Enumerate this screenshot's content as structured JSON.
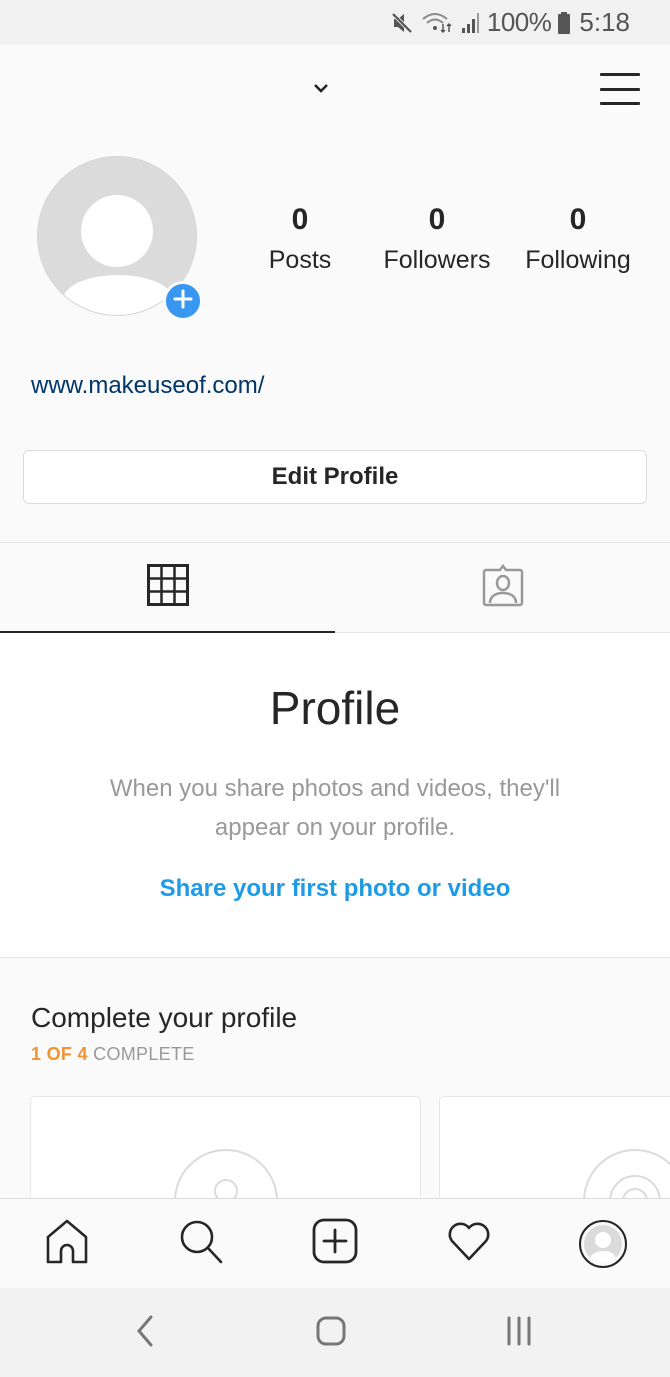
{
  "status_bar": {
    "icons": [
      "mute-icon",
      "wifi-icon",
      "signal-icon",
      "battery-icon"
    ],
    "battery_percent": "100%",
    "time": "5:18"
  },
  "header": {
    "username": "",
    "dropdown_icon": "chevron-down-icon",
    "menu_icon": "hamburger-menu-icon"
  },
  "profile": {
    "avatar_icon": "default-avatar-icon",
    "add_photo_icon": "plus-icon",
    "stats": [
      {
        "value": "0",
        "label": "Posts"
      },
      {
        "value": "0",
        "label": "Followers"
      },
      {
        "value": "0",
        "label": "Following"
      }
    ],
    "website": "www.makeuseof.com/",
    "edit_profile_label": "Edit Profile"
  },
  "tabs": [
    {
      "name": "grid",
      "icon": "grid-icon",
      "active": true
    },
    {
      "name": "tagged",
      "icon": "tagged-person-icon",
      "active": false
    }
  ],
  "empty_state": {
    "title": "Profile",
    "description": "When you share photos and videos, they'll appear on your profile.",
    "cta": "Share your first photo or video"
  },
  "complete_profile": {
    "title": "Complete your profile",
    "progress_done": "1 OF 4",
    "progress_rest": "COMPLETE",
    "completed_steps": 1,
    "total_steps": 4,
    "accent_color": "#f09433"
  },
  "bottom_nav": [
    {
      "name": "home",
      "icon": "home-icon"
    },
    {
      "name": "search",
      "icon": "search-icon"
    },
    {
      "name": "new-post",
      "icon": "add-post-icon"
    },
    {
      "name": "activity",
      "icon": "heart-icon"
    },
    {
      "name": "profile",
      "icon": "profile-avatar-icon"
    }
  ],
  "system_nav": [
    {
      "name": "back",
      "icon": "back-icon"
    },
    {
      "name": "home",
      "icon": "home-square-icon"
    },
    {
      "name": "recents",
      "icon": "recents-icon"
    }
  ],
  "colors": {
    "link_blue": "#1c9be6",
    "website_blue": "#003569",
    "badge_blue": "#3897f0",
    "text_dark": "#262626",
    "text_muted": "#999999"
  }
}
